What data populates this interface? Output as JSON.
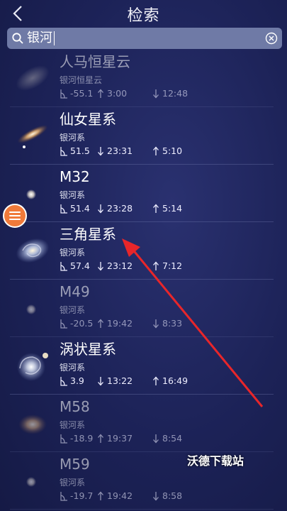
{
  "header": {
    "title": "检索",
    "back_icon": "back-chevron-icon"
  },
  "search": {
    "value": "银河",
    "search_icon": "search-icon",
    "clear_icon": "clear-icon"
  },
  "results": [
    {
      "name": "人马恒星云",
      "sub": "银河恒星云",
      "alt": "-55.1",
      "t1_dir": "up",
      "t1": "3:00",
      "t2_dir": "down",
      "t2": "12:48",
      "dim": true,
      "thumb": "cloud"
    },
    {
      "name": "仙女星系",
      "sub": "银河系",
      "alt": "51.5",
      "t1_dir": "down",
      "t1": "23:31",
      "t2_dir": "up",
      "t2": "5:10",
      "dim": false,
      "thumb": "edge"
    },
    {
      "name": "M32",
      "sub": "银河系",
      "alt": "51.4",
      "t1_dir": "down",
      "t1": "23:28",
      "t2_dir": "up",
      "t2": "5:14",
      "dim": false,
      "thumb": "dot"
    },
    {
      "name": "三角星系",
      "sub": "银河系",
      "alt": "57.4",
      "t1_dir": "down",
      "t1": "23:12",
      "t2_dir": "up",
      "t2": "7:12",
      "dim": false,
      "thumb": "spiral"
    },
    {
      "name": "M49",
      "sub": "银河系",
      "alt": "-20.5",
      "t1_dir": "up",
      "t1": "19:42",
      "t2_dir": "down",
      "t2": "8:33",
      "dim": true,
      "thumb": "dot"
    },
    {
      "name": "涡状星系",
      "sub": "银河系",
      "alt": "3.9",
      "t1_dir": "down",
      "t1": "13:22",
      "t2_dir": "up",
      "t2": "16:49",
      "dim": false,
      "thumb": "whirl"
    },
    {
      "name": "M58",
      "sub": "银河系",
      "alt": "-18.9",
      "t1_dir": "up",
      "t1": "19:37",
      "t2_dir": "down",
      "t2": "8:54",
      "dim": true,
      "thumb": "oval"
    },
    {
      "name": "M59",
      "sub": "银河系",
      "alt": "-19.7",
      "t1_dir": "up",
      "t1": "19:42",
      "t2_dir": "down",
      "t2": "8:58",
      "dim": true,
      "thumb": "dot"
    }
  ],
  "fab": {
    "icon": "menu-icon",
    "color": "#f07a3a"
  },
  "annotation": {
    "arrow_color": "#e8262a"
  },
  "watermark": "沃德下载站"
}
